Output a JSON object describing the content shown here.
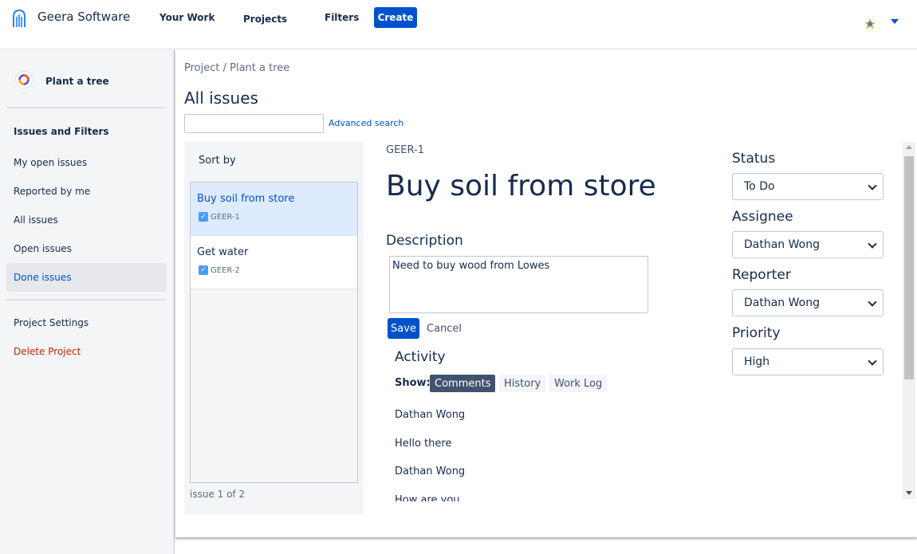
{
  "header": {
    "brand": "Geera Software",
    "nav": {
      "your_work": "Your Work",
      "projects": "Projects",
      "filters": "Filters"
    },
    "create_label": "Create",
    "avatar_icon": "user-avatar-icon",
    "accent": "#0052cc"
  },
  "sidebar": {
    "project_name": "Plant a tree",
    "section_heading": "Issues and Filters",
    "items": [
      {
        "label": "My open issues"
      },
      {
        "label": "Reported by me"
      },
      {
        "label": "All issues"
      },
      {
        "label": "Open issues"
      },
      {
        "label": "Done issues"
      }
    ],
    "settings_label": "Project Settings",
    "delete_label": "Delete Project"
  },
  "main": {
    "breadcrumb": "Project / Plant a tree",
    "title": "All issues",
    "search": {
      "value": "",
      "placeholder": ""
    },
    "advanced_search": "Advanced search",
    "list": {
      "sort_label": "Sort by",
      "issues": [
        {
          "title": "Buy soil from store",
          "key": "GEER-1",
          "selected": true
        },
        {
          "title": "Get water",
          "key": "GEER-2",
          "selected": false
        }
      ],
      "pager": "issue 1 of 2"
    },
    "detail": {
      "key": "GEER-1",
      "title": "Buy soil from store",
      "description_label": "Description",
      "description_value": "Need to buy wood from Lowes",
      "save_label": "Save",
      "cancel_label": "Cancel",
      "activity_label": "Activity",
      "show_label": "Show:",
      "tabs": {
        "comments": "Comments",
        "history": "History",
        "worklog": "Work Log"
      },
      "comments": [
        "Dathan Wong",
        "Hello there",
        "Dathan Wong",
        "How are you"
      ]
    },
    "fields": {
      "status": {
        "label": "Status",
        "value": "To Do"
      },
      "assignee": {
        "label": "Assignee",
        "value": "Dathan Wong"
      },
      "reporter": {
        "label": "Reporter",
        "value": "Dathan Wong"
      },
      "priority": {
        "label": "Priority",
        "value": "High"
      }
    }
  }
}
